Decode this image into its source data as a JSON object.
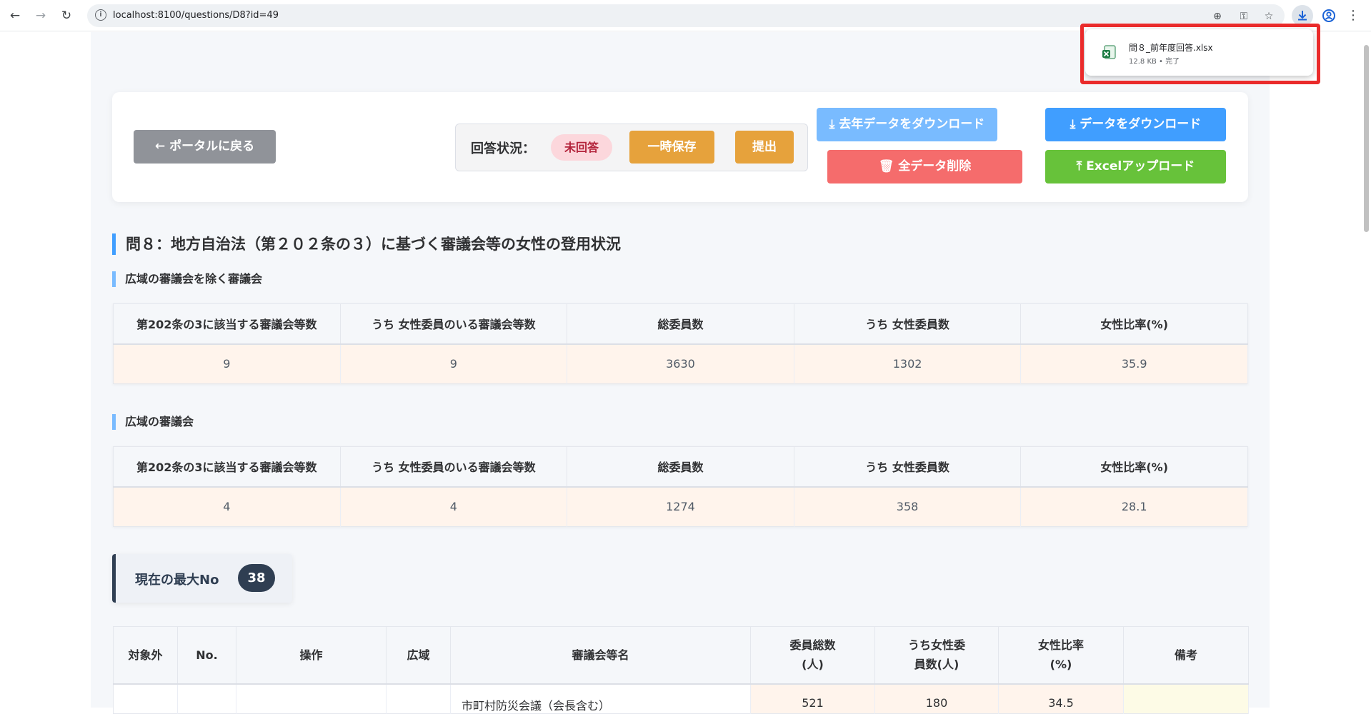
{
  "browser": {
    "url": "localhost:8100/questions/D8?id=49",
    "download": {
      "file_name": "問８_前年度回答.xlsx",
      "meta": "12.8 KB • 完了"
    }
  },
  "toolbar": {
    "back_label": "← ポータルに戻る",
    "status_label": "回答状況：",
    "status_value": "未回答",
    "temp_save_label": "一時保存",
    "submit_label": "提出",
    "last_year_download_label": "⤓ 去年データをダウンロード",
    "download_label": "⤓ データをダウンロード",
    "delete_all_label": "🗑 全データ削除",
    "excel_upload_label": "⤒ Excelアップロード"
  },
  "question_title": "問８：地方自治法（第２０２条の３）に基づく審議会等の女性の登用状況",
  "summary_sections": [
    {
      "title": "広域の審議会を除く審議会",
      "headers": [
        "第202条の3に該当する審議会等数",
        "うち 女性委員のいる審議会等数",
        "総委員数",
        "うち 女性委員数",
        "女性比率(%)"
      ],
      "values": [
        "9",
        "9",
        "3630",
        "1302",
        "35.9"
      ]
    },
    {
      "title": "広域の審議会",
      "headers": [
        "第202条の3に該当する審議会等数",
        "うち 女性委員のいる審議会等数",
        "総委員数",
        "うち 女性委員数",
        "女性比率(%)"
      ],
      "values": [
        "4",
        "4",
        "1274",
        "358",
        "28.1"
      ]
    }
  ],
  "max_no": {
    "label": "現在の最大No",
    "value": "38"
  },
  "list_table": {
    "headers": [
      "対象外",
      "No.",
      "操作",
      "広域",
      "審議会等名",
      "委員総数\n(人)",
      "うち女性委\n員数(人)",
      "女性比率\n(%)",
      "備考"
    ],
    "first_row": {
      "name": "市町村防災会議（会長含む）",
      "total": "521",
      "women": "180",
      "ratio": "34.5"
    }
  }
}
